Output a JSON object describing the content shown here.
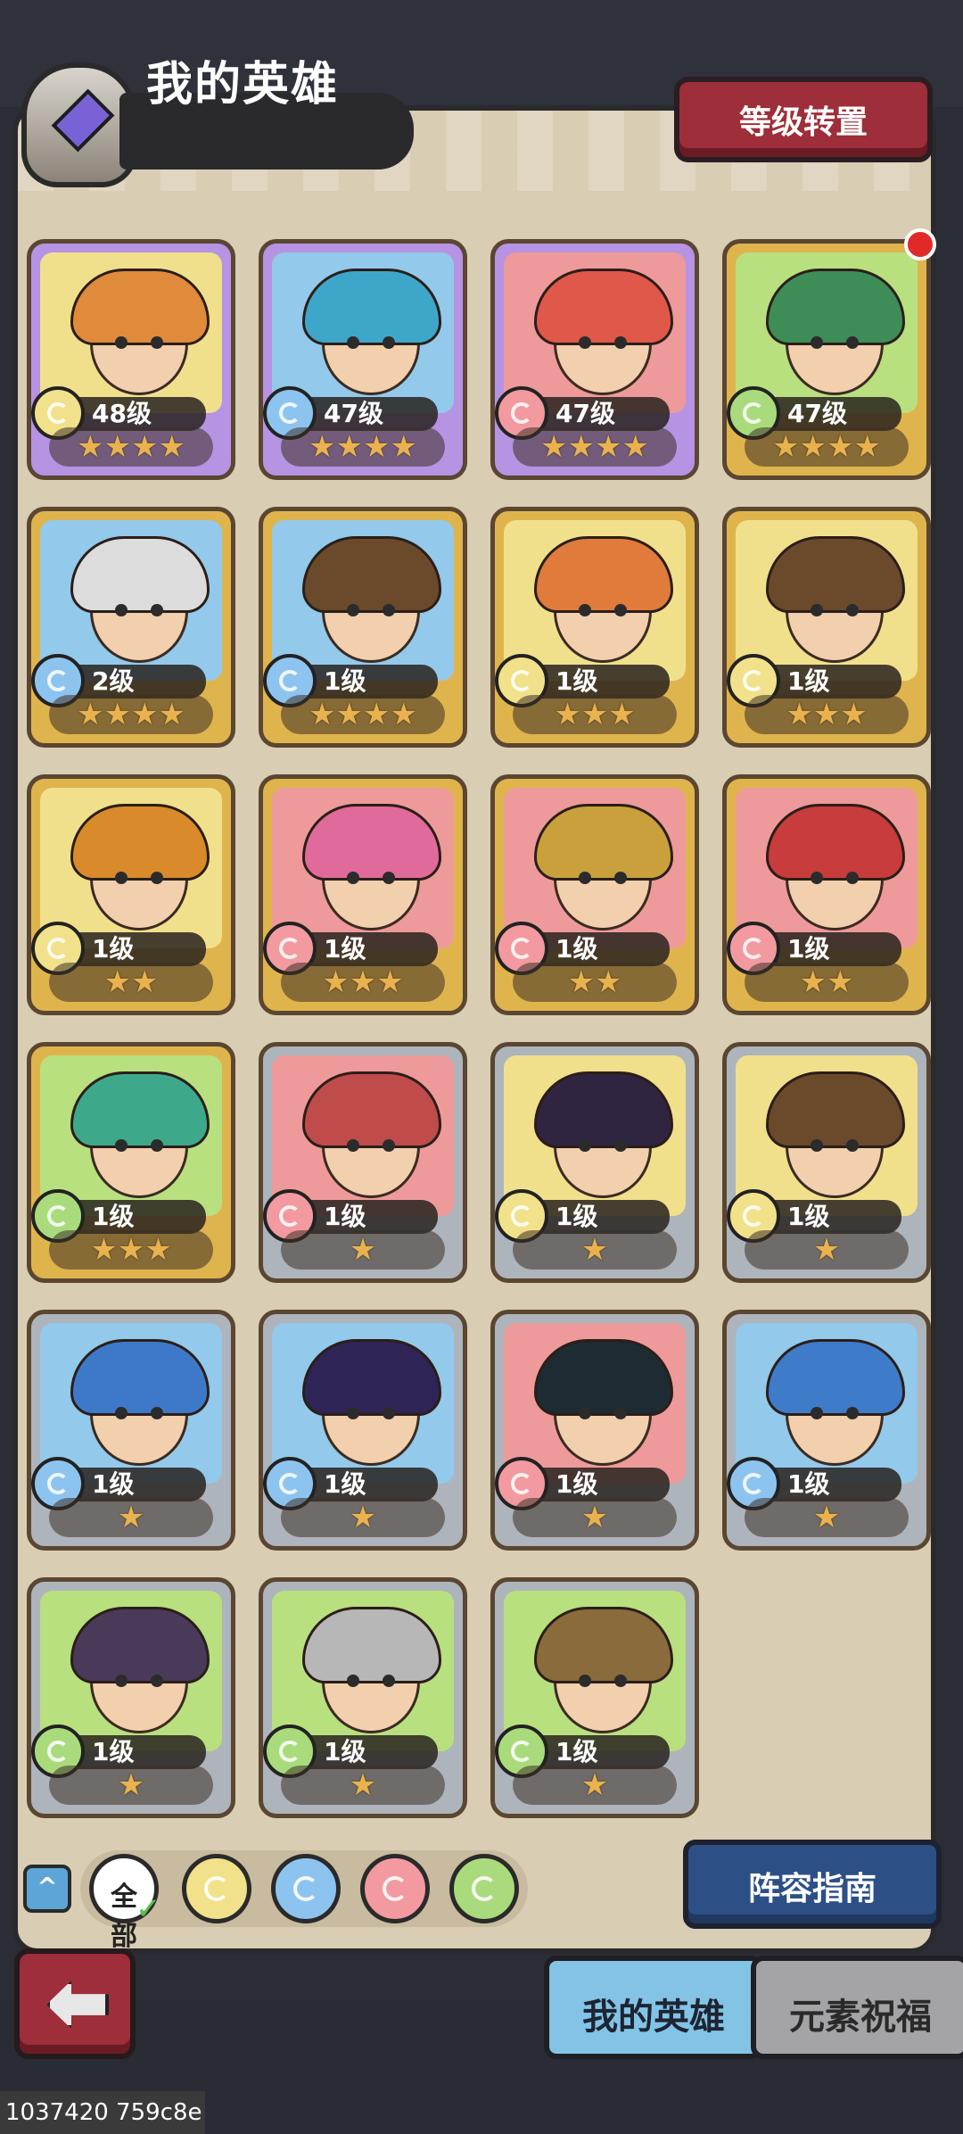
{
  "header": {
    "title": "我的英雄",
    "level_transfer_button": "等级转置"
  },
  "heroes": [
    {
      "level": "48级",
      "stars": "★★★★",
      "element": "wind",
      "rarity": "purple"
    },
    {
      "level": "47级",
      "stars": "★★★★",
      "element": "water",
      "rarity": "purple"
    },
    {
      "level": "47级",
      "stars": "★★★★",
      "element": "fire",
      "rarity": "purple"
    },
    {
      "level": "47级",
      "stars": "★★★★",
      "element": "earth",
      "rarity": "gold"
    },
    {
      "level": "2级",
      "stars": "★★★★",
      "element": "water",
      "rarity": "gold"
    },
    {
      "level": "1级",
      "stars": "★★★★",
      "element": "water",
      "rarity": "gold"
    },
    {
      "level": "1级",
      "stars": "★★★",
      "element": "wind",
      "rarity": "gold"
    },
    {
      "level": "1级",
      "stars": "★★★",
      "element": "wind",
      "rarity": "gold"
    },
    {
      "level": "1级",
      "stars": "★★",
      "element": "wind",
      "rarity": "gold"
    },
    {
      "level": "1级",
      "stars": "★★★",
      "element": "fire",
      "rarity": "gold"
    },
    {
      "level": "1级",
      "stars": "★★",
      "element": "fire",
      "rarity": "gold"
    },
    {
      "level": "1级",
      "stars": "★★",
      "element": "fire",
      "rarity": "gold"
    },
    {
      "level": "1级",
      "stars": "★★★",
      "element": "earth",
      "rarity": "gold"
    },
    {
      "level": "1级",
      "stars": "★",
      "element": "fire",
      "rarity": "silver"
    },
    {
      "level": "1级",
      "stars": "★",
      "element": "wind",
      "rarity": "silver"
    },
    {
      "level": "1级",
      "stars": "★",
      "element": "wind",
      "rarity": "silver"
    },
    {
      "level": "1级",
      "stars": "★",
      "element": "water",
      "rarity": "silver"
    },
    {
      "level": "1级",
      "stars": "★",
      "element": "water",
      "rarity": "silver"
    },
    {
      "level": "1级",
      "stars": "★",
      "element": "fire",
      "rarity": "silver"
    },
    {
      "level": "1级",
      "stars": "★",
      "element": "water",
      "rarity": "silver"
    },
    {
      "level": "1级",
      "stars": "★",
      "element": "earth",
      "rarity": "silver"
    },
    {
      "level": "1级",
      "stars": "★",
      "element": "earth",
      "rarity": "silver"
    },
    {
      "level": "1级",
      "stars": "★",
      "element": "earth",
      "rarity": "silver"
    }
  ],
  "filter": {
    "all_label": "全部",
    "elements": [
      "wind",
      "water",
      "fire",
      "earth"
    ]
  },
  "lineup_guide_button": "阵容指南",
  "tabs": {
    "my_heroes": "我的英雄",
    "element_blessing": "元素祝福"
  },
  "build_id": "1037420 759c8e"
}
